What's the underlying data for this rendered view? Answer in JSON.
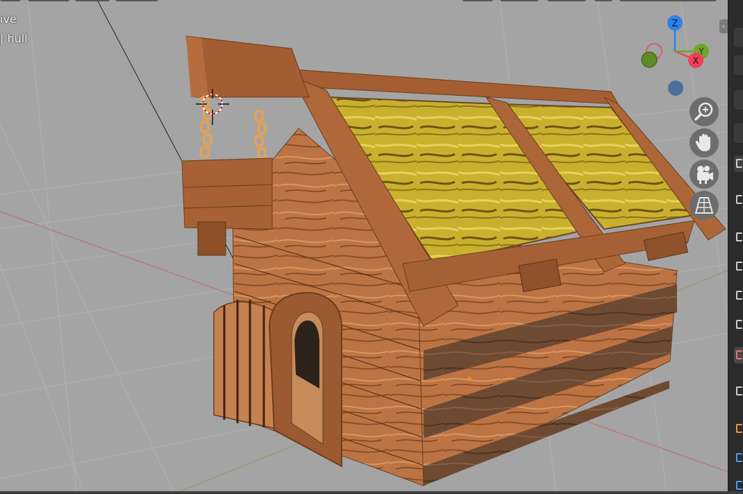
{
  "viewport": {
    "mode_text": "ive",
    "object_text": "| hull"
  },
  "gizmo": {
    "z_label": "Z",
    "y_label": "Y",
    "x_label": "X",
    "colors": {
      "x": "#f0405a",
      "y": "#6fa42c",
      "z": "#2d82e8"
    }
  },
  "navigation": {
    "zoom_icon": "zoom-in-icon",
    "pan_icon": "hand-pan-icon",
    "camera_icon": "camera-icon",
    "perspective_icon": "perspective-grid-icon"
  },
  "properties_tabs": [
    "tool-icon",
    "render-icon",
    "output-icon",
    "view-layer-icon",
    "scene-icon",
    "world-icon",
    "object-icon",
    "modifier-icon",
    "particles-icon",
    "physics-icon"
  ]
}
